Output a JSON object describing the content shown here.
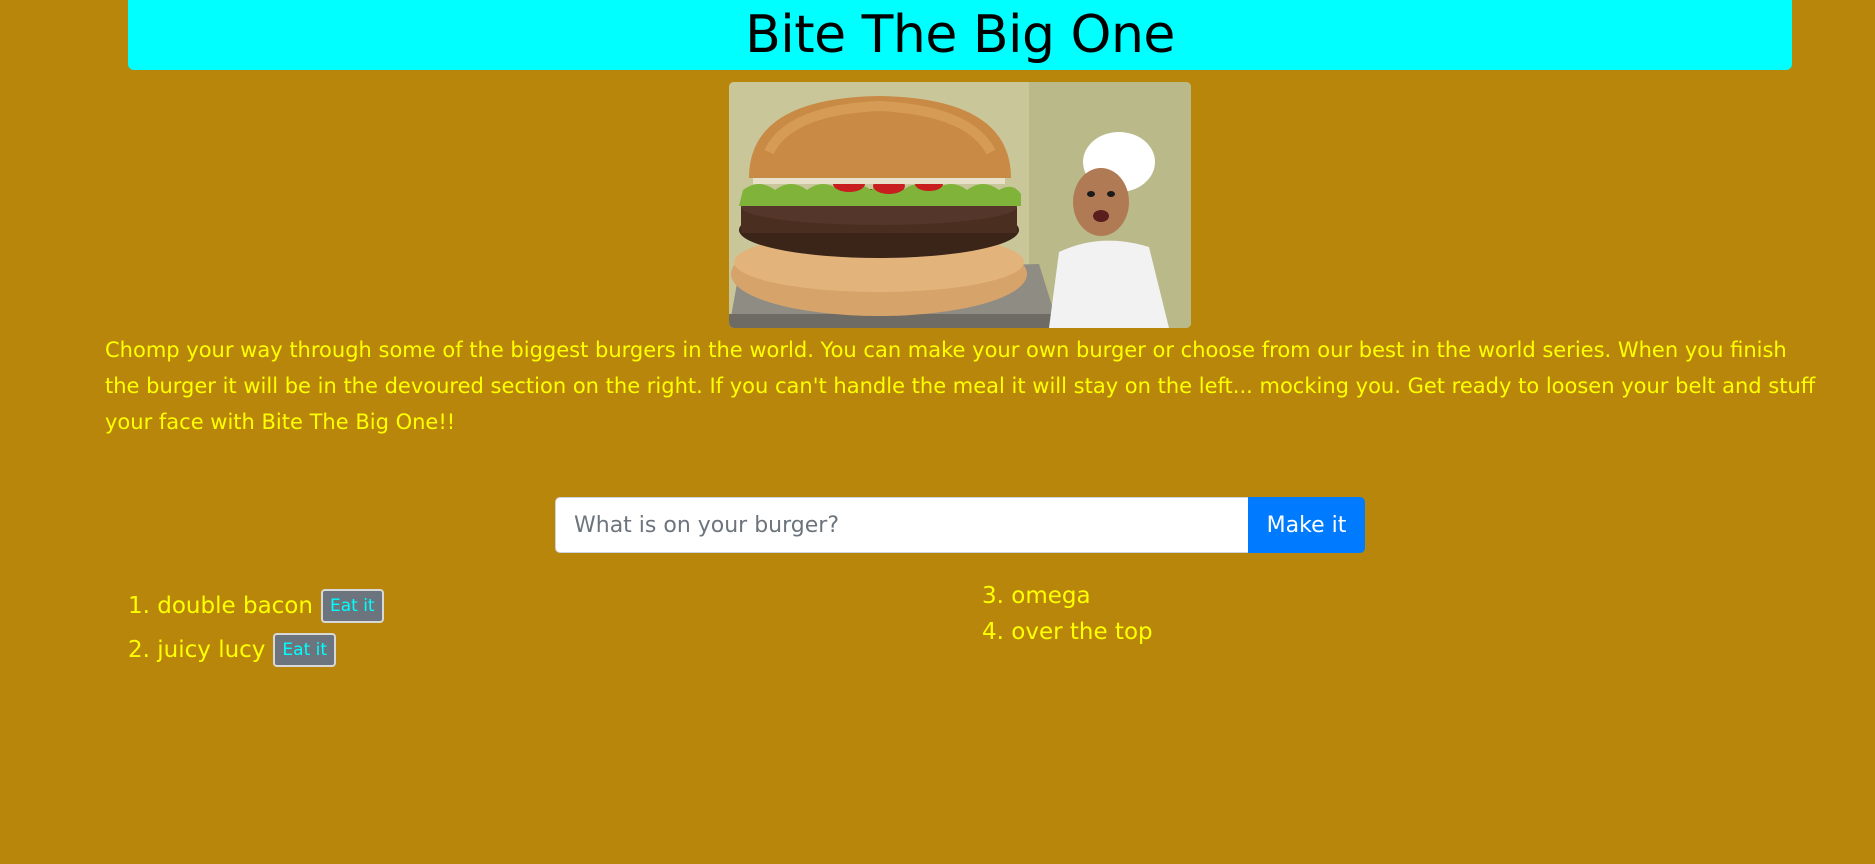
{
  "header": {
    "title": "Bite The Big One"
  },
  "hero": {
    "image_subject": "giant-burger-with-chef-photo"
  },
  "intro": {
    "text": "Chomp your way through some of the biggest burgers in the world. You can make your own burger or choose from our best in the world series. When you finish the burger it will be in the devoured section on the right. If you can't handle the meal it will stay on the left... mocking you. Get ready to loosen your belt and stuff your face with Bite The Big One!!"
  },
  "form": {
    "input_placeholder": "What is on your burger?",
    "input_value": "",
    "submit_label": "Make it"
  },
  "uneaten": {
    "eat_label": "Eat it",
    "items": [
      {
        "number": "1.",
        "name": "double bacon"
      },
      {
        "number": "2.",
        "name": "juicy lucy"
      }
    ]
  },
  "devoured": {
    "items": [
      {
        "number": "3.",
        "name": "omega"
      },
      {
        "number": "4.",
        "name": "over the top"
      }
    ]
  },
  "colors": {
    "background": "#b8860b",
    "header_bg": "#00ffff",
    "text_yellow": "#ffff00",
    "button_blue": "#007bff",
    "eat_button_bg": "#6c757d",
    "eat_button_text": "#00ffff"
  }
}
